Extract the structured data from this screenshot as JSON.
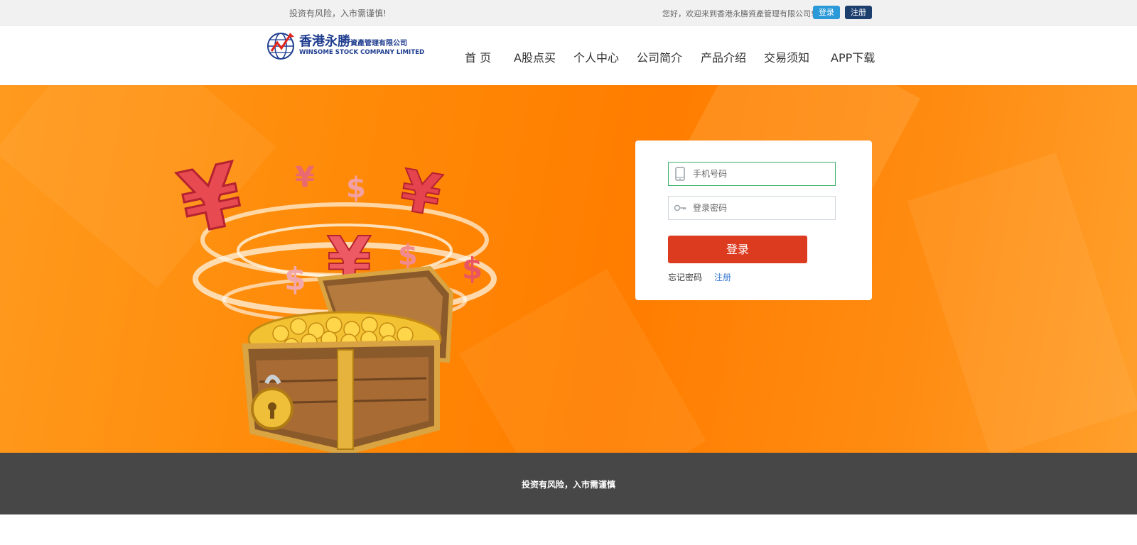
{
  "topbar": {
    "risk_notice": "投资有风险，入市需谨慎!",
    "welcome": "您好，欢迎来到香港永勝資產管理有限公司!",
    "login_label": "登录",
    "register_label": "注册"
  },
  "logo": {
    "name_cn": "香港永勝",
    "name_cn_small": "資產管理有限公司",
    "name_en": "WINSOME STOCK COMPANY LIMITED"
  },
  "nav": [
    {
      "label": "首 页"
    },
    {
      "label": "A股点买"
    },
    {
      "label": "个人中心"
    },
    {
      "label": "公司简介"
    },
    {
      "label": "产品介绍"
    },
    {
      "label": "交易须知"
    },
    {
      "label": "APP下载"
    }
  ],
  "login_form": {
    "phone_placeholder": "手机号码",
    "password_placeholder": "登录密码",
    "submit_label": "登录",
    "forgot_label": "忘记密码",
    "register_label": "注册",
    "phone_icon": "phone-icon",
    "key_icon": "key-icon"
  },
  "hero": {
    "illustration": "treasure-chest-with-currency-symbols"
  },
  "footer": {
    "notice": "投资有风险，入市需谨慎"
  },
  "colors": {
    "accent_orange": "#ff8a08",
    "login_button": "#dc3b20",
    "topbar_login": "#2c9ad9",
    "topbar_register": "#1c3f6e",
    "footer_bg": "#474747"
  }
}
